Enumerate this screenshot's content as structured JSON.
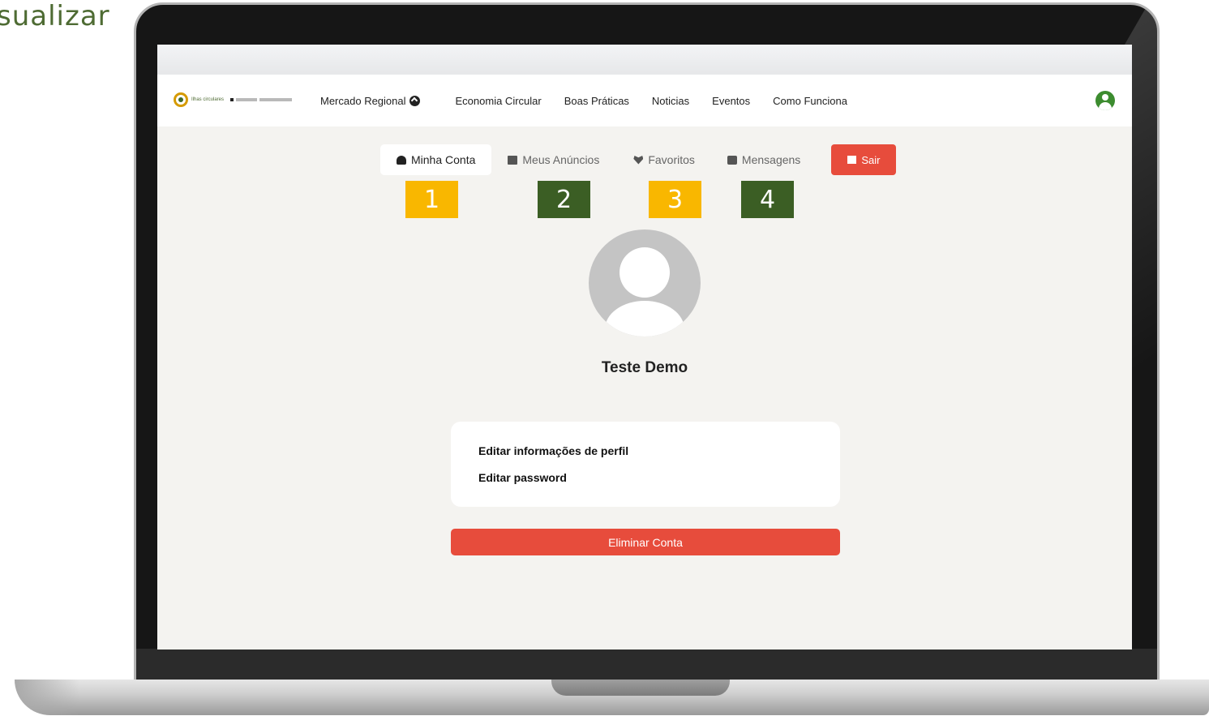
{
  "slide": {
    "heading_fragment": "sualizar"
  },
  "navbar": {
    "logo_text": "Ilhas circulares",
    "links": [
      {
        "label": "Mercado Regional"
      },
      {
        "label": "Economia Circular"
      },
      {
        "label": "Boas Práticas"
      },
      {
        "label": "Noticias"
      },
      {
        "label": "Eventos"
      },
      {
        "label": "Como Funciona"
      }
    ]
  },
  "tabs": [
    {
      "label": "Minha Conta",
      "icon": "user-icon",
      "active": true
    },
    {
      "label": "Meus Anúncios",
      "icon": "list-icon",
      "active": false
    },
    {
      "label": "Favoritos",
      "icon": "heart-icon",
      "active": false
    },
    {
      "label": "Mensagens",
      "icon": "chat-icon",
      "active": false
    }
  ],
  "logout": {
    "label": "Sair",
    "icon": "sign-out-icon"
  },
  "markers": [
    {
      "label": "1",
      "color": "#f9b700"
    },
    {
      "label": "2",
      "color": "#3b5e24"
    },
    {
      "label": "3",
      "color": "#f9b700"
    },
    {
      "label": "4",
      "color": "#3b5e24"
    }
  ],
  "profile": {
    "name": "Teste Demo"
  },
  "settings": {
    "edit_profile": "Editar informações de perfil",
    "edit_password": "Editar password"
  },
  "danger": {
    "delete_account": "Eliminar Conta"
  },
  "colors": {
    "accent_red": "#e74c3c",
    "brand_green": "#3c8c2f",
    "page_bg": "#f4f3f0"
  }
}
